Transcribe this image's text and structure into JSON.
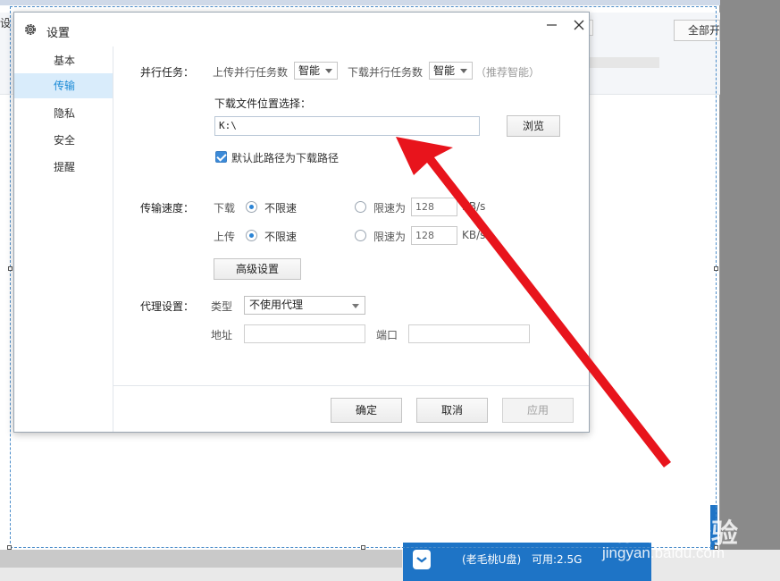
{
  "background": {
    "left_label": "设",
    "all_button": "全部开",
    "usb": {
      "name": "(老毛桃U盘)",
      "free": "可用:2.5G"
    }
  },
  "dialog": {
    "title": "设置",
    "nav": [
      {
        "label": "基本",
        "active": false
      },
      {
        "label": "传输",
        "active": true
      },
      {
        "label": "隐私",
        "active": false
      },
      {
        "label": "安全",
        "active": false
      },
      {
        "label": "提醒",
        "active": false
      }
    ],
    "parallel": {
      "label": "并行任务：",
      "upload_label": "上传并行任务数",
      "upload_value": "智能",
      "download_label": "下载并行任务数",
      "download_value": "智能",
      "hint": "（推荐智能）"
    },
    "download_location": {
      "label": "下载文件位置选择：",
      "path": "K:\\",
      "browse": "浏览",
      "default_checkbox_label": "默认此路径为下载路径",
      "default_checked": true
    },
    "speed": {
      "label": "传输速度：",
      "download": {
        "label": "下载",
        "unlimited": "不限速",
        "limit_label": "限速为",
        "limit_placeholder": "128",
        "unit": "KB/s",
        "selected": "unlimited"
      },
      "upload": {
        "label": "上传",
        "unlimited": "不限速",
        "limit_label": "限速为",
        "limit_placeholder": "128",
        "unit": "KB/s",
        "selected": "unlimited"
      },
      "advanced": "高级设置"
    },
    "proxy": {
      "label": "代理设置：",
      "type_label": "类型",
      "type_value": "不使用代理",
      "address_label": "地址",
      "port_label": "端口"
    },
    "footer": {
      "ok": "确定",
      "cancel": "取消",
      "apply": "应用"
    }
  },
  "watermark": {
    "logo": "Bai du 经验",
    "url": "jingyan.baidu.com"
  },
  "colors": {
    "accent": "#1a8ad6",
    "active_nav_bg": "#d9ecfb",
    "arrow": "#e8141c",
    "usb_tile": "#1e74c6"
  }
}
